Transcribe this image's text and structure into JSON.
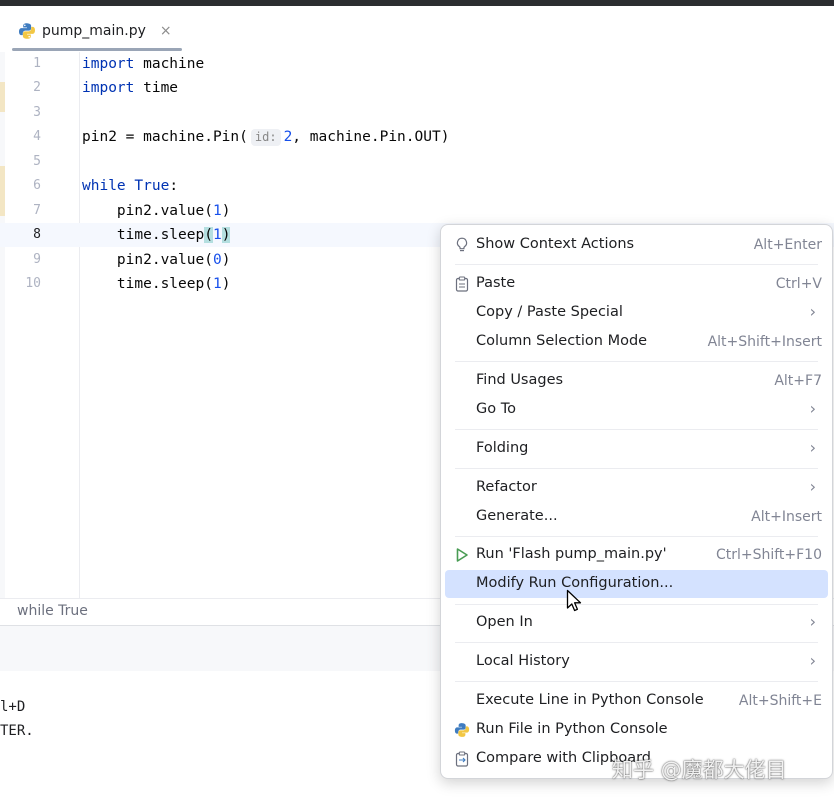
{
  "tab": {
    "title": "pump_main.py",
    "close": "×"
  },
  "editor": {
    "line_numbers": [
      "1",
      "2",
      "3",
      "4",
      "5",
      "6",
      "7",
      "8",
      "9",
      "10"
    ],
    "code": {
      "l1_kw": "import",
      "l1_rest": " machine",
      "l2_kw": "import",
      "l2_rest": " time",
      "l4_a": "pin2 = machine.Pin(",
      "l4_hint": "id:",
      "l4_num": "2",
      "l4_b": ", machine.Pin.OUT)",
      "l6_kw": "while",
      "l6_sp": " ",
      "l6_true": "True",
      "l6_colon": ":",
      "l7_a": "    pin2.value(",
      "l7_num": "1",
      "l7_b": ")",
      "l8_a": "    time.sleep",
      "l8_open": "(",
      "l8_num": "1",
      "l8_close": ")",
      "l9_a": "    pin2.value(",
      "l9_num": "0",
      "l9_b": ")",
      "l10_a": "    time.sleep(",
      "l10_num": "1",
      "l10_b": ")"
    }
  },
  "breadcrumb": "while True",
  "console": {
    "line1": "l+D",
    "line2": "TER."
  },
  "context_menu": {
    "show_context_actions": {
      "label": "Show Context Actions",
      "shortcut": "Alt+Enter"
    },
    "paste": {
      "label": "Paste",
      "shortcut": "Ctrl+V"
    },
    "copy_paste_special": {
      "label": "Copy / Paste Special"
    },
    "column_selection_mode": {
      "label": "Column Selection Mode",
      "shortcut": "Alt+Shift+Insert"
    },
    "find_usages": {
      "label": "Find Usages",
      "shortcut": "Alt+F7"
    },
    "go_to": {
      "label": "Go To"
    },
    "folding": {
      "label": "Folding"
    },
    "refactor": {
      "label": "Refactor"
    },
    "generate": {
      "label": "Generate...",
      "shortcut": "Alt+Insert"
    },
    "run": {
      "label": "Run 'Flash pump_main.py'",
      "shortcut": "Ctrl+Shift+F10"
    },
    "modify_run_config": {
      "label": "Modify Run Configuration..."
    },
    "open_in": {
      "label": "Open In"
    },
    "local_history": {
      "label": "Local History"
    },
    "execute_line": {
      "label": "Execute Line in Python Console",
      "shortcut": "Alt+Shift+E"
    },
    "run_file_console": {
      "label": "Run File in Python Console"
    },
    "compare_clipboard": {
      "label": "Compare with Clipboard"
    },
    "submenu_glyph": "›"
  },
  "watermark": "知乎 @魔都大佬目",
  "colors": {
    "keyword": "#0033b3",
    "number": "#1750eb",
    "selection": "#d4e2ff",
    "run_icon": "#499c54",
    "python_blue": "#3f7cc0",
    "python_yellow": "#f2c744"
  }
}
